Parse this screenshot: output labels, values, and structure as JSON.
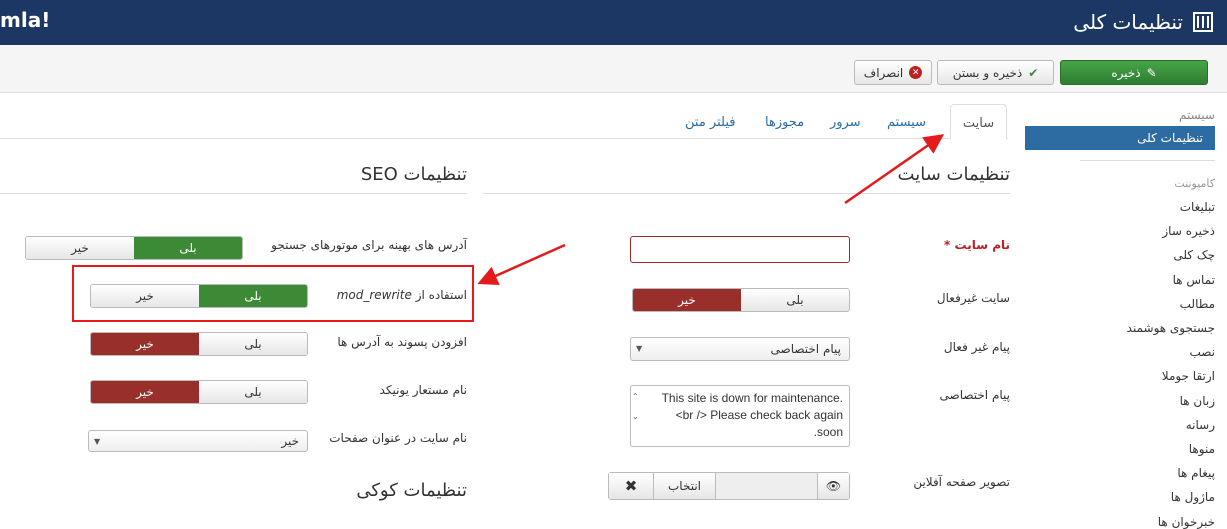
{
  "header": {
    "logo": "mla!",
    "title": "تنظیمات کلی",
    "title_icon": "sliders-icon",
    "bg": "#1c3764"
  },
  "toolbar": {
    "save": "ذخیره",
    "save_close": "ذخیره و بستن",
    "cancel": "انصراف"
  },
  "sidebar": {
    "system_heading": "سیستم",
    "active": "تنظیمات کلی",
    "component_heading": "کامپوننت",
    "items": [
      "تبلیغات",
      "ذخیره ساز",
      "چک کلی",
      "تماس ها",
      "مطالب",
      "جستجوی هوشمند",
      "نصب",
      "ارتقا جوملا",
      "زبان ها",
      "رسانه",
      "منوها",
      "پیغام ها",
      "ماژول ها",
      "خبرخوان ها"
    ]
  },
  "tabs": [
    "سایت",
    "سیستم",
    "سرور",
    "مجوزها",
    "فیلتر متن"
  ],
  "site": {
    "heading": "تنظیمات سایت",
    "site_name_label": "نام سایت *",
    "site_name_value": "",
    "offline_label": "سایت غیرفعال",
    "yes": "بلی",
    "no": "خیر",
    "offline_msg_label": "پیام غیر فعال",
    "offline_msg_value": "پیام اختصاصی",
    "custom_msg_label": "پیام اختصاصی",
    "custom_msg_value": "This site is down for maintenance.<br /> Please check back again soon.",
    "offline_image_label": "تصویر صفحه آفلاین",
    "select": "انتخاب"
  },
  "seo": {
    "heading": "تنظیمات SEO",
    "sef_label": "آدرس های بهینه برای موتورهای جستجو",
    "rewrite_label": "استفاده از",
    "rewrite_code": "mod_rewrite",
    "suffix_label": "افزودن پسوند به آدرس ها",
    "unicode_label": "نام مستعار یونیکد",
    "sitename_title_label": "نام سایت در عنوان صفحات",
    "sitename_title_value": "خیر",
    "yes": "بلی",
    "no": "خیر"
  },
  "cookie": {
    "heading": "تنظیمات کوکی"
  },
  "colors": {
    "green": "#3c8a35",
    "red": "#982f2b",
    "annotation": "#e51b1b",
    "active": "#2d6ca2"
  }
}
